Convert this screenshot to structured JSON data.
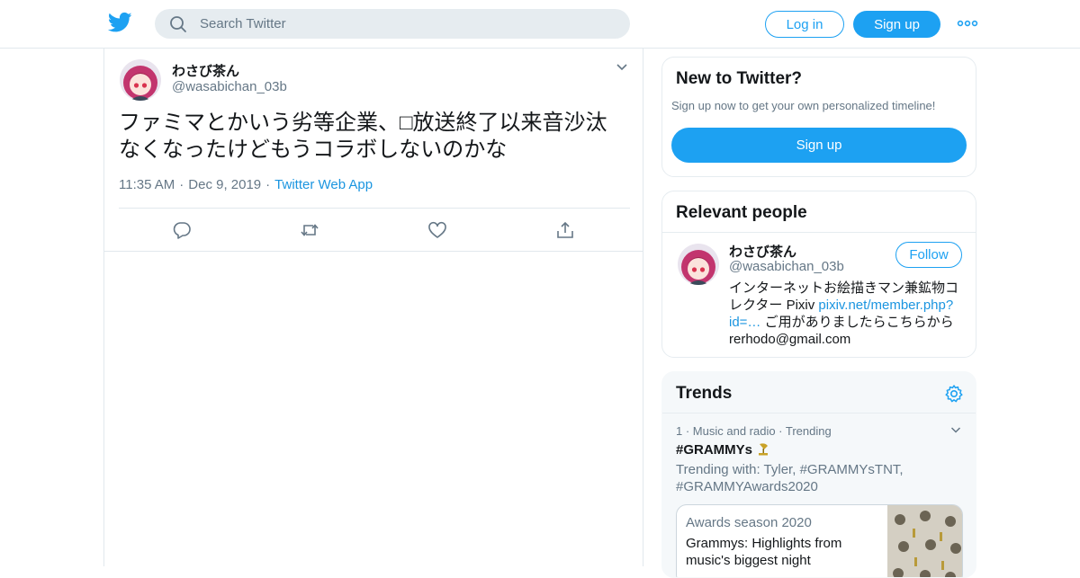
{
  "header": {
    "search_placeholder": "Search Twitter",
    "login_label": "Log in",
    "signup_label": "Sign up",
    "brand_color": "#1da1f2"
  },
  "tweet": {
    "author_name": "わさび茶ん",
    "author_handle": "@wasabichan_03b",
    "text": "ファミマとかいう劣等企業、□放送終了以来音沙汰なくなったけどもうコラボしないのかな",
    "time": "11:35 AM",
    "date": "Dec 9, 2019",
    "source": "Twitter Web App",
    "actions": [
      "reply-icon",
      "retweet-icon",
      "like-icon",
      "share-icon"
    ]
  },
  "sidebar": {
    "new_to_twitter": {
      "title": "New to Twitter?",
      "subtitle": "Sign up now to get your own personalized timeline!",
      "signup_label": "Sign up"
    },
    "relevant_people": {
      "title": "Relevant people",
      "person": {
        "name": "わさび茶ん",
        "handle": "@wasabichan_03b",
        "follow_label": "Follow",
        "bio_start": "インターネットお絵描きマン兼鉱物コレクター Pixiv ",
        "bio_link": "pixiv.net/member.php?id=…",
        "bio_end": " ご用がありましたらこちらから rerhodo@gmail.com"
      }
    },
    "trends": {
      "title": "Trends",
      "item": {
        "rank": "1",
        "category": "Music and radio · Trending",
        "name": "#GRAMMYs",
        "trending_with": "Trending with: Tyler, #GRAMMYsTNT, #GRAMMYAwards2020",
        "news_label": "Awards season 2020",
        "news_title": "Grammys: Highlights from music's biggest night"
      }
    }
  }
}
